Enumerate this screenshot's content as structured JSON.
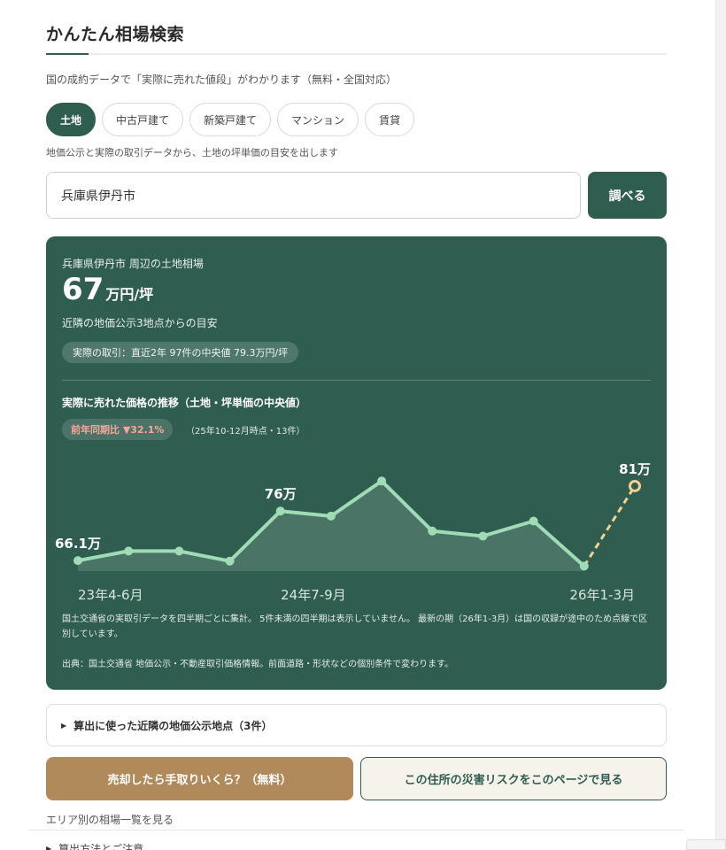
{
  "page": {
    "title": "かんたん相場検索",
    "subtitle": "国の成約データで「実際に売れた値段」がわかります（無料・全国対応）"
  },
  "tabs": [
    {
      "label": "土地",
      "active": true
    },
    {
      "label": "中古戸建て",
      "active": false
    },
    {
      "label": "新築戸建て",
      "active": false
    },
    {
      "label": "マンション",
      "active": false
    },
    {
      "label": "賃貸",
      "active": false
    }
  ],
  "hint": "地価公示と実際の取引データから、土地の坪単価の目安を出します",
  "search": {
    "value": "兵庫県伊丹市",
    "button_label": "調べる"
  },
  "result": {
    "area_label": "兵庫県伊丹市 周辺の土地相場",
    "price_value": "67",
    "price_unit": "万円/坪",
    "basis": "近隣の地価公示3地点からの目安",
    "actual_pill": "実際の取引：直近2年 97件の中央値 79.3万円/坪",
    "trend_title": "実際に売れた価格の推移（土地・坪単価の中央値）",
    "yoy_label": "前年同期比 ▼32.1%",
    "yoy_note": "（25年10-12月時点・13件）",
    "footnote1": "国土交通省の実取引データを四半期ごとに集計。 5件未満の四半期は表示していません。 最新の期（26年1-3月）は国の収録が途中のため点線で区別しています。",
    "footnote2": "出典：国土交通省 地価公示・不動産取引価格情報。前面道路・形状などの個別条件で変わります。"
  },
  "chart_data": {
    "type": "line",
    "unit": "万円/坪",
    "x_tick_labels": [
      "23年4-6月",
      "24年7-9月",
      "26年1-3月"
    ],
    "series": [
      {
        "values": [
          66.1,
          68,
          68,
          66,
          76,
          75,
          82,
          72,
          71,
          74,
          65,
          81
        ],
        "last_point_provisional": true
      }
    ],
    "data_labels": [
      {
        "index": 0,
        "text": "66.1万"
      },
      {
        "index": 4,
        "text": "76万"
      },
      {
        "index": 11,
        "text": "81万"
      }
    ],
    "ylim": [
      64,
      84
    ],
    "colors": {
      "line": "#9fdcb6",
      "fill": "#4a7466",
      "provisional": "#f2d08e"
    }
  },
  "details_toggle": "算出に使った近隣の地価公示地点（3件）",
  "actions": {
    "sell_label": "売却したら手取りいくら？（無料）",
    "risk_label": "この住所の災害リスクをこのページで見る"
  },
  "footer": {
    "area_link": "エリア別の相場一覧を見る",
    "method_label": "算出方法とご注意"
  },
  "colors": {
    "brand": "#2f5d50",
    "sell": "#b08a5a",
    "decrease": "#f3a897"
  }
}
